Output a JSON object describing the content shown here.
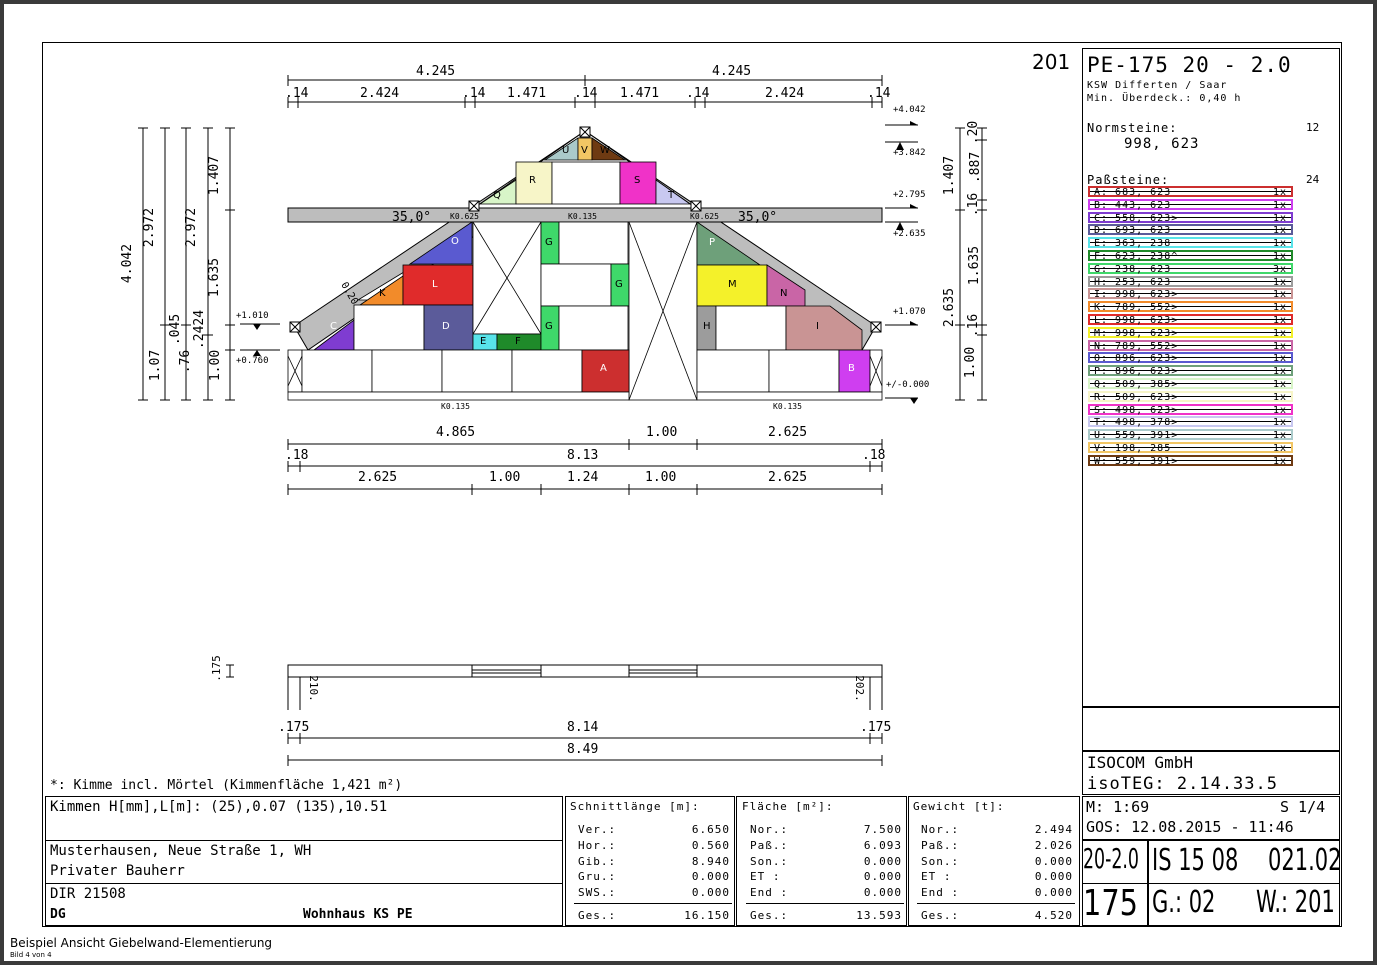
{
  "header": {
    "sheet_number": "201",
    "product": "PE-175 20 - 2.0",
    "plant": "KSW Differten / Saar",
    "min_overlap": "Min. Überdeck.: 0,40 h",
    "norm_label": "Normsteine:",
    "norm_count": "12",
    "norm_values": "998, 623",
    "pass_label": "Paßsteine:",
    "pass_count": "24"
  },
  "legend": [
    {
      "text": "A:  683,  623",
      "qty": "1x",
      "color": "#cc2f2f"
    },
    {
      "text": "B:  443,  623",
      "qty": "1x",
      "color": "#cf3ef0"
    },
    {
      "text": "C:  558,  623>",
      "qty": "1x",
      "color": "#7f3cd1"
    },
    {
      "text": "D:  693,  623",
      "qty": "1x",
      "color": "#5b5b9a"
    },
    {
      "text": "E:  363,  238",
      "qty": "1x",
      "color": "#58e4ea"
    },
    {
      "text": "F:  623,  238^",
      "qty": "1x",
      "color": "#1f8a2a"
    },
    {
      "text": "G:  238,  623",
      "qty": "3x",
      "color": "#3fd86a"
    },
    {
      "text": "H:  253,  623",
      "qty": "1x",
      "color": "#9c9c9c"
    },
    {
      "text": "I:  998,  623>",
      "qty": "1x",
      "color": "#c99494"
    },
    {
      "text": "K:  789,  552>",
      "qty": "1x",
      "color": "#f28b2a"
    },
    {
      "text": "L:  998,  623>",
      "qty": "1x",
      "color": "#e02b2b"
    },
    {
      "text": "M:  998,  623>",
      "qty": "1x",
      "color": "#f4f12a"
    },
    {
      "text": "N:  789,  552>",
      "qty": "1x",
      "color": "#c965a6"
    },
    {
      "text": "O:  896,  623>",
      "qty": "1x",
      "color": "#5a5ad0"
    },
    {
      "text": "P:  896,  623>",
      "qty": "1x",
      "color": "#6ea07a"
    },
    {
      "text": "Q:  509,  385>",
      "qty": "1x",
      "color": "#d8f5c8"
    },
    {
      "text": "R:  509,  623>",
      "qty": "1x",
      "color": "#f7f5c8"
    },
    {
      "text": "S:  498,  623>",
      "qty": "1x",
      "color": "#f032c8"
    },
    {
      "text": "T:  498,  378>",
      "qty": "1x",
      "color": "#c8c8f0"
    },
    {
      "text": "U:  559,  391>",
      "qty": "1x",
      "color": "#aacaca"
    },
    {
      "text": "V:  198,  285",
      "qty": "1x",
      "color": "#f2c664"
    },
    {
      "text": "W:  559,  391>",
      "qty": "1x",
      "color": "#6e3a12"
    }
  ],
  "drawing": {
    "top_dims_1": [
      "4.245",
      "4.245"
    ],
    "top_dims_2": [
      ".14",
      "2.424",
      ".14",
      "1.471",
      ".14",
      "1.471",
      ".14",
      "2.424",
      ".14"
    ],
    "bottom_dims_1": [
      "4.865",
      "1.00",
      "2.625"
    ],
    "bottom_dims_2": [
      ".18",
      "8.13",
      ".18"
    ],
    "bottom_dims_3": [
      "2.625",
      "1.00",
      "1.24",
      "1.00",
      "2.625"
    ],
    "left_dims": [
      "4.042",
      "2.972",
      "2.972",
      "1.407",
      "1.635",
      "1.00",
      "1.07",
      ".045",
      ".76",
      ".2424"
    ],
    "right_dims": [
      "1.407",
      ".16",
      ".887",
      ".20",
      "1.635",
      "2.635",
      ".16",
      "1.00"
    ],
    "levels": [
      "+4.042",
      "+3.842",
      "+2.795",
      "+2.635",
      "+1.070",
      "+/-0.000",
      "+1.010",
      "+0.760"
    ],
    "angles": [
      "35,0°",
      "35,0°"
    ],
    "ko_labels": [
      "K0.625",
      "K0.135",
      "K0.625",
      "K0.135",
      "K0.135"
    ],
    "slope_label": "0,20",
    "plan_dims_1": [
      ".175",
      "8.14",
      ".175"
    ],
    "plan_total": "8.49",
    "plan_side": [
      ".175",
      "210.",
      "202."
    ]
  },
  "note": "*: Kimme incl. Mörtel  (Kimmenfläche 1,421 m²)",
  "kimmen": "Kimmen H[mm],L[m]: (25),0.07 (135),10.51",
  "address": [
    "Musterhausen, Neue Straße 1, WH",
    "Privater Bauherr"
  ],
  "dir": "DIR 21508",
  "floor": "DG",
  "building": "Wohnhaus KS PE",
  "schnitt": {
    "title": "Schnittlänge [m]:",
    "rows": [
      [
        "Ver.:",
        "6.650"
      ],
      [
        "Hor.:",
        "0.560"
      ],
      [
        "Gib.:",
        "8.940"
      ],
      [
        "Gru.:",
        "0.000"
      ],
      [
        "SWS.:",
        "0.000"
      ]
    ],
    "total": [
      "Ges.:",
      "16.150"
    ]
  },
  "flaeche": {
    "title": "Fläche [m²]:",
    "rows": [
      [
        "Nor.:",
        "7.500"
      ],
      [
        "Paß.:",
        "6.093"
      ],
      [
        "Son.:",
        "0.000"
      ],
      [
        "ET  :",
        "0.000"
      ],
      [
        "End :",
        "0.000"
      ]
    ],
    "total": [
      "Ges.:",
      "13.593"
    ]
  },
  "gewicht": {
    "title": "Gewicht [t]:",
    "rows": [
      [
        "Nor.:",
        "2.494"
      ],
      [
        "Paß.:",
        "2.026"
      ],
      [
        "Son.:",
        "0.000"
      ],
      [
        "ET  :",
        "0.000"
      ],
      [
        "End :",
        "0.000"
      ]
    ],
    "total": [
      "Ges.:",
      "4.520"
    ]
  },
  "company": "ISOCOM GmbH",
  "software": "isoTEG: 2.14.33.5",
  "scale": "M: 1:69",
  "page": "S 1/4",
  "gos": "GOS: 12.08.2015 - 11:46",
  "code_big_1": "20-2.0",
  "code_big_2": "175",
  "is_code": "IS 15 08",
  "num_code": "021.02",
  "g_code": "G.: 02",
  "w_code": "W.: 201",
  "caption": "Beispiel Ansicht Giebelwand-Elementierung",
  "subcaption": "Bild 4 von 4"
}
